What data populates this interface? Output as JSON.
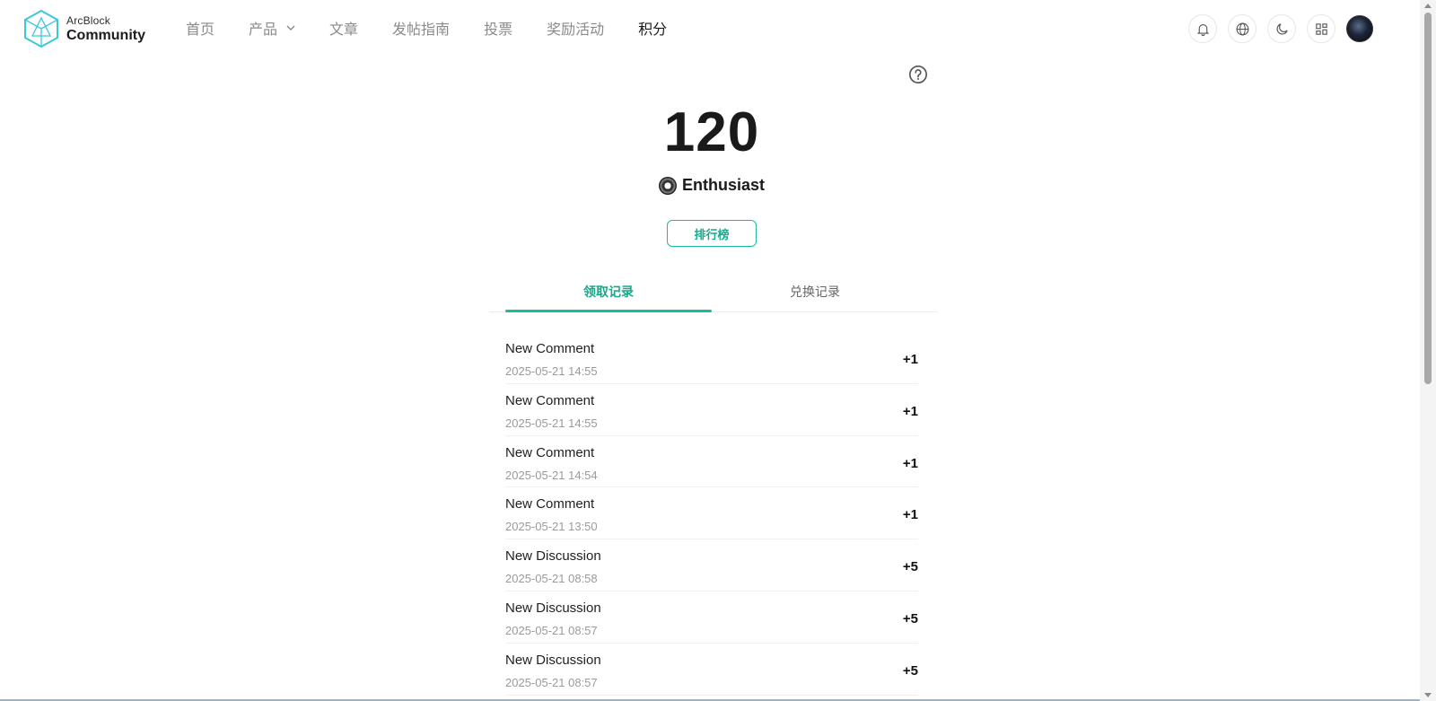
{
  "brand": {
    "top": "ArcBlock",
    "bottom": "Community"
  },
  "nav": [
    {
      "label": "首页",
      "active": false,
      "dropdown": false
    },
    {
      "label": "产品",
      "active": false,
      "dropdown": true
    },
    {
      "label": "文章",
      "active": false,
      "dropdown": false
    },
    {
      "label": "发帖指南",
      "active": false,
      "dropdown": false
    },
    {
      "label": "投票",
      "active": false,
      "dropdown": false
    },
    {
      "label": "奖励活动",
      "active": false,
      "dropdown": false
    },
    {
      "label": "积分",
      "active": true,
      "dropdown": false
    }
  ],
  "actions": [
    "bell-icon",
    "globe-icon",
    "moon-icon",
    "apps-grid-icon",
    "avatar"
  ],
  "points": {
    "total": "120",
    "level": "Enthusiast",
    "leaderboard_label": "排行榜"
  },
  "tabs": [
    {
      "label": "领取记录",
      "active": true
    },
    {
      "label": "兑换记录",
      "active": false
    }
  ],
  "records": [
    {
      "title": "New Comment",
      "time": "2025-05-21 14:55",
      "delta": "+1"
    },
    {
      "title": "New Comment",
      "time": "2025-05-21 14:55",
      "delta": "+1"
    },
    {
      "title": "New Comment",
      "time": "2025-05-21 14:54",
      "delta": "+1"
    },
    {
      "title": "New Comment",
      "time": "2025-05-21 13:50",
      "delta": "+1"
    },
    {
      "title": "New Discussion",
      "time": "2025-05-21 08:58",
      "delta": "+5"
    },
    {
      "title": "New Discussion",
      "time": "2025-05-21 08:57",
      "delta": "+5"
    },
    {
      "title": "New Discussion",
      "time": "2025-05-21 08:57",
      "delta": "+5"
    }
  ],
  "colors": {
    "accent": "#1abc9c",
    "text": "#1f1f1f",
    "muted": "#9a9a9a"
  }
}
